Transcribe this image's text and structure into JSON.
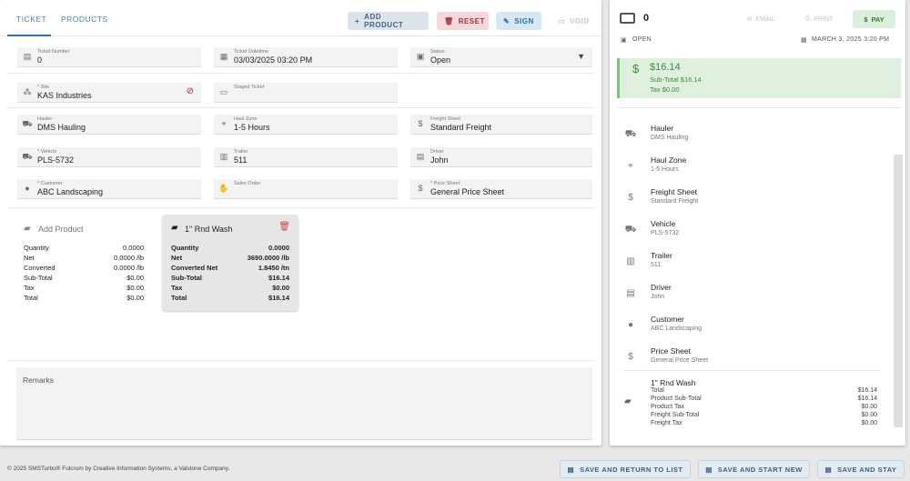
{
  "tabs": [
    {
      "label": "TICKET"
    },
    {
      "label": "PRODUCTS"
    }
  ],
  "toolbar": {
    "add_product": "ADD PRODUCT",
    "reset": "RESET",
    "sign": "SIGN",
    "void": "VOID"
  },
  "fields": {
    "ticket_number": {
      "label": "Ticket Number",
      "value": "0"
    },
    "ticket_datetime": {
      "label": "Ticket Datetime",
      "value": "03/03/2025 03:20 PM"
    },
    "status": {
      "label": "Status",
      "value": "Open"
    },
    "site": {
      "label": "* Site",
      "value": "KAS Industries"
    },
    "staged_ticket": {
      "label": "Staged Ticket",
      "value": ""
    },
    "hauler": {
      "label": "Hauler",
      "value": "DMS Hauling"
    },
    "haul_zone": {
      "label": "Haul Zone",
      "value": "1-5 Hours"
    },
    "freight_sheet": {
      "label": "Freight Sheet",
      "value": "Standard Freight"
    },
    "vehicle": {
      "label": "* Vehicle",
      "value": "PLS-5732"
    },
    "trailer": {
      "label": "Trailer",
      "value": "511"
    },
    "driver": {
      "label": "Driver",
      "value": "John"
    },
    "customer": {
      "label": "* Customer",
      "value": "ABC Landscaping"
    },
    "sales_order": {
      "label": "Sales Order",
      "value": ""
    },
    "price_sheet": {
      "label": "* Price Sheet",
      "value": "General Price Sheet"
    }
  },
  "add_product_card": {
    "title": "Add Product",
    "rows": [
      {
        "label": "Quantity",
        "value": "0.0000"
      },
      {
        "label": "Net",
        "value": "0.0000 /lb"
      },
      {
        "label": "Converted",
        "value": "0.0000 /lb"
      },
      {
        "label": "Sub-Total",
        "value": "$0.00"
      },
      {
        "label": "Tax",
        "value": "$0.00"
      },
      {
        "label": "Total",
        "value": "$0.00"
      }
    ]
  },
  "wash_card": {
    "title": "1\" Rnd Wash",
    "rows": [
      {
        "label": "Quantity",
        "value": "0.0000"
      },
      {
        "label": "Net",
        "value": "3690.0000 /lb"
      },
      {
        "label": "Converted Net",
        "value": "1.8450 /tn"
      },
      {
        "label": "Sub-Total",
        "value": "$16.14"
      },
      {
        "label": "Tax",
        "value": "$0.00"
      },
      {
        "label": "Total",
        "value": "$16.14"
      }
    ]
  },
  "remarks_label": "Remarks",
  "footer": {
    "copyright": "© 2025 SMSTurbo® Fulcrum by Creative Information Systems, a Valstone Company.",
    "save_return": "SAVE AND RETURN TO LIST",
    "save_new": "SAVE AND START NEW",
    "save_stay": "SAVE AND STAY"
  },
  "right": {
    "ticket_no": "0",
    "email": "EMAIL",
    "print": "PRINT",
    "pay": "PAY",
    "status": "OPEN",
    "datetime": "MARCH 3, 2025 3:20 PM",
    "summary": {
      "total": "$16.14",
      "subtotal": "Sub-Total $16.14",
      "tax": "Tax $0.00"
    },
    "items": [
      {
        "title": "Hauler",
        "sub": "DMS Hauling",
        "icon": "truck-icon"
      },
      {
        "title": "Haul Zone",
        "sub": "1-5 Hours",
        "icon": "map-icon"
      },
      {
        "title": "Freight Sheet",
        "sub": "Standard Freight",
        "icon": "money-icon"
      },
      {
        "title": "Vehicle",
        "sub": "PLS-5732",
        "icon": "truck-icon"
      },
      {
        "title": "Trailer",
        "sub": "511",
        "icon": "trailer-icon"
      },
      {
        "title": "Driver",
        "sub": "John",
        "icon": "id-card-icon"
      },
      {
        "title": "Customer",
        "sub": "ABC Landscaping",
        "icon": "user-icon"
      },
      {
        "title": "Price Sheet",
        "sub": "General Price Sheet",
        "icon": "dollar-icon"
      }
    ],
    "wash": {
      "title": "1\" Rnd Wash",
      "rows": [
        {
          "label": "Total",
          "value": "$16.14"
        },
        {
          "label": "Product Sub-Total",
          "value": "$16.14"
        },
        {
          "label": "Product Tax",
          "value": "$0.00"
        },
        {
          "label": "Freight Sub-Total",
          "value": "$0.00"
        },
        {
          "label": "Freight Tax",
          "value": "$0.00"
        }
      ]
    }
  },
  "colors": {
    "accent": "#3a6fa8",
    "danger": "#a4323f",
    "success": "#3d8b3d",
    "summary_bg": "#dff0df"
  }
}
